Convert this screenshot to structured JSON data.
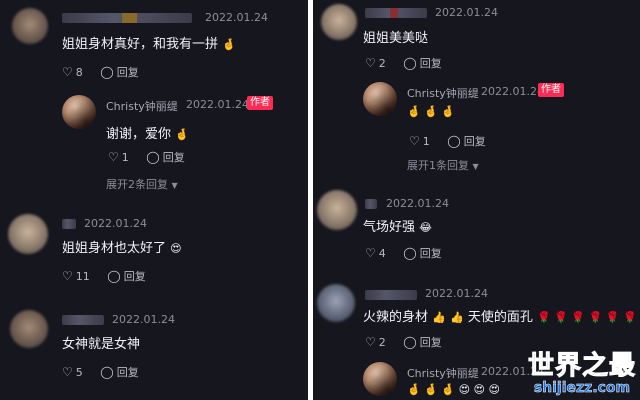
{
  "left": {
    "comments": [
      {
        "date": "2022.01.24",
        "text": "姐姐身材真好，和我有一拼",
        "emoji": "🤞",
        "likes": "8",
        "reply_label": "回复"
      },
      {
        "author": "Christy钟丽缇",
        "author_tag": "作者",
        "date": "2022.01.24",
        "text": "谢谢，爱你",
        "emoji": "🤞",
        "likes": "1",
        "reply_label": "回复",
        "expand_label": "展开2条回复"
      },
      {
        "date": "2022.01.24",
        "text": "姐姐身材也太好了",
        "emoji": "😍",
        "likes": "11",
        "reply_label": "回复"
      },
      {
        "date": "2022.01.24",
        "text": "女神就是女神",
        "emoji": "",
        "likes": "5",
        "reply_label": "回复"
      }
    ]
  },
  "right": {
    "comments": [
      {
        "date": "2022.01.24",
        "text": "姐姐美美哒",
        "emoji": "",
        "likes": "2",
        "reply_label": "回复"
      },
      {
        "author": "Christy钟丽缇",
        "author_tag": "作者",
        "date": "2022.01.24",
        "text": "",
        "emoji": "🤞 🤞 🤞",
        "likes": "1",
        "reply_label": "回复",
        "expand_label": "展开1条回复"
      },
      {
        "date": "2022.01.24",
        "text": "气场好强",
        "emoji": "😂",
        "likes": "4",
        "reply_label": "回复"
      },
      {
        "date": "2022.01.24",
        "text": "火辣的身材",
        "text2": "天使的面孔",
        "emoji": "👍",
        "emoji2": "👍",
        "emoji3": "🌹 🌹 🌹 🌹 🌹 🌹",
        "likes": "2",
        "reply_label": "回复"
      },
      {
        "author": "Christy钟丽缇",
        "date": "2022.01.24",
        "emoji": "🤞 🤞 🤞 😍 😍 😍"
      }
    ]
  },
  "watermark": {
    "line1": "世界之最",
    "line2": "shijiezz.com"
  },
  "icons": {
    "like": "heart-outline-icon",
    "reply": "comment-bubble-icon",
    "expand": "chevron-down-icon"
  },
  "colors": {
    "author_tag": "#fe2c55",
    "background": "#16161f",
    "watermark": "#1e6fd8"
  }
}
